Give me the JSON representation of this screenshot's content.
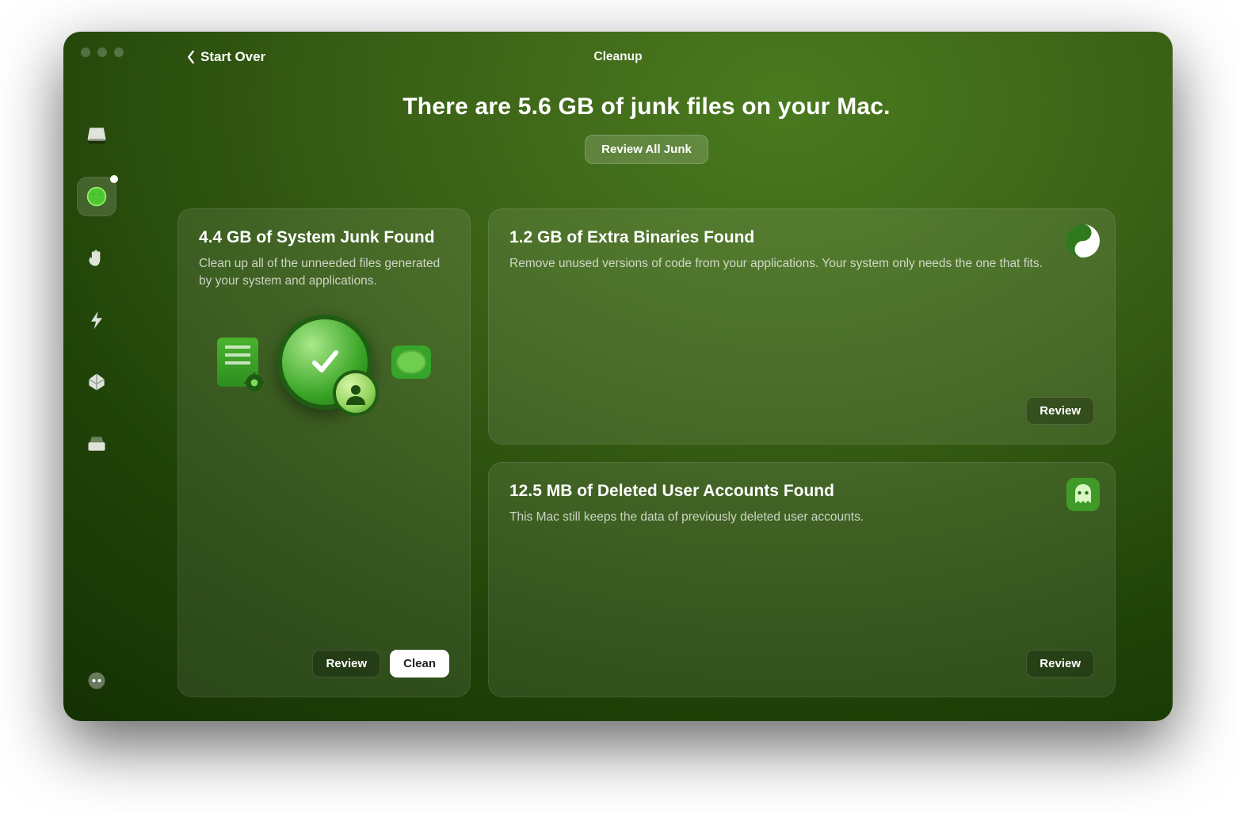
{
  "header": {
    "back_label": "Start Over",
    "title": "Cleanup"
  },
  "hero": {
    "headline": "There are 5.6 GB of junk files on your Mac.",
    "review_all_label": "Review All Junk"
  },
  "sidebar": {
    "items": [
      {
        "name": "smart-care",
        "icon": "disk-icon"
      },
      {
        "name": "cleanup",
        "icon": "cleanup-icon",
        "active": true,
        "badge": true
      },
      {
        "name": "protection",
        "icon": "hand-icon"
      },
      {
        "name": "performance",
        "icon": "bolt-icon"
      },
      {
        "name": "applications",
        "icon": "apps-icon"
      },
      {
        "name": "my-clutter",
        "icon": "drive-icon"
      }
    ],
    "assistant_icon": "assistant-icon"
  },
  "cards": {
    "system_junk": {
      "title": "4.4 GB of System Junk Found",
      "desc": "Clean up all of the unneeded files generated by your system and applications.",
      "review_label": "Review",
      "clean_label": "Clean"
    },
    "extra_binaries": {
      "title": "1.2 GB of Extra Binaries Found",
      "desc": "Remove unused versions of code from your applications. Your system only needs the one that fits.",
      "review_label": "Review"
    },
    "deleted_users": {
      "title": "12.5 MB of Deleted User Accounts Found",
      "desc": "This Mac still keeps the data of previously deleted user accounts.",
      "review_label": "Review"
    }
  }
}
